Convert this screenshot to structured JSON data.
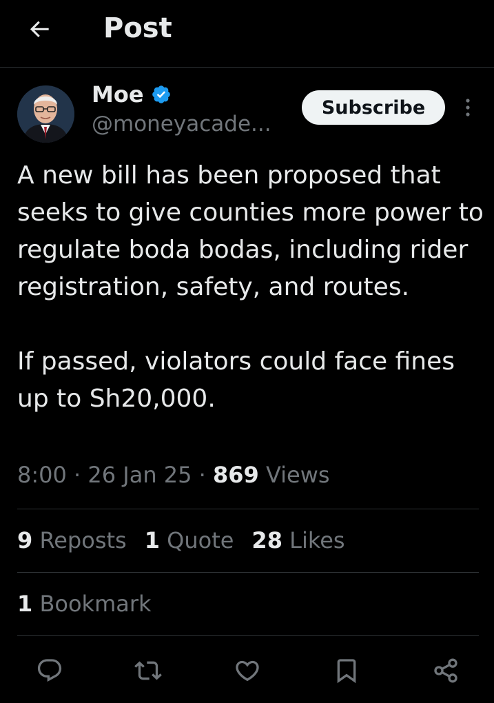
{
  "header": {
    "title": "Post",
    "back_icon": "arrow-left-icon"
  },
  "author": {
    "name": "Moe",
    "handle": "@moneyacade...",
    "verified_icon": "verified-badge-icon",
    "verified_color": "#1d9bf0"
  },
  "subscribe_label": "Subscribe",
  "more_icon": "more-vertical-icon",
  "tweet": {
    "paragraphs": [
      "A new bill has been proposed that seeks to give counties more power to regulate boda bodas, including rider registration, safety, and routes.",
      "If passed, violators could face fines up to Sh20,000."
    ]
  },
  "meta": {
    "time": "8:00",
    "date": "26 Jan 25",
    "views_count": "869",
    "views_label": "Views",
    "separator": "·"
  },
  "stats": {
    "reposts_count": "9",
    "reposts_label": "Reposts",
    "quotes_count": "1",
    "quotes_label": "Quote",
    "likes_count": "28",
    "likes_label": "Likes",
    "bookmarks_count": "1",
    "bookmarks_label": "Bookmark"
  },
  "actions": [
    "reply-icon",
    "repost-icon",
    "like-icon",
    "bookmark-icon",
    "share-icon"
  ],
  "colors": {
    "background": "#000000",
    "text": "#e7e9ea",
    "muted": "#71767b",
    "divider": "#2f3336",
    "accent": "#1d9bf0"
  }
}
